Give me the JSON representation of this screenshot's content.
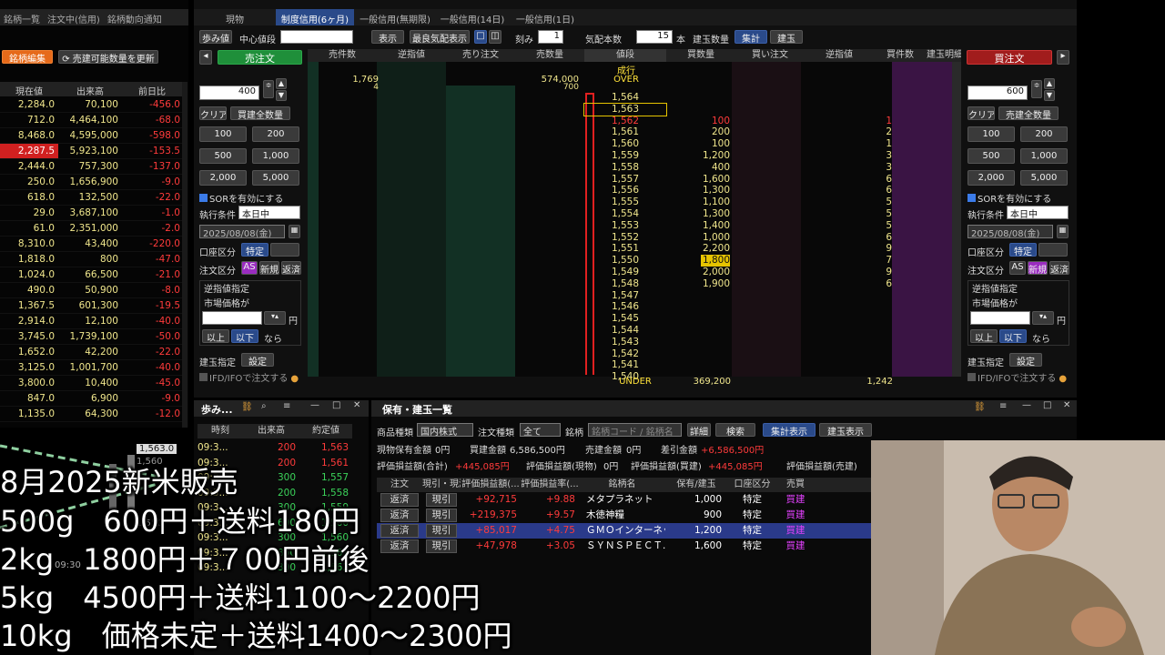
{
  "top_tabs": [
    "銘柄一覧",
    "注文中(信用)",
    "銘柄動向通知"
  ],
  "mid_tabs": [
    "現物",
    "制度信用(6ヶ月)",
    "一般信用(無期限)",
    "一般信用(14日)",
    "一般信用(1日)"
  ],
  "left_list": {
    "edit_label": "銘柄編集",
    "update_label": "売建可能数量を更新",
    "headers": [
      "現在値",
      "出来高",
      "前日比"
    ],
    "rows": [
      [
        "2,284.0",
        "70,100",
        "-456.0"
      ],
      [
        "712.0",
        "4,464,100",
        "-68.0"
      ],
      [
        "8,468.0",
        "4,595,000",
        "-598.0"
      ],
      [
        "2,287.5",
        "5,923,100",
        "-153.5"
      ],
      [
        "2,444.0",
        "757,300",
        "-137.0"
      ],
      [
        "250.0",
        "1,656,900",
        "-9.0"
      ],
      [
        "618.0",
        "132,500",
        "-22.0"
      ],
      [
        "29.0",
        "3,687,100",
        "-1.0"
      ],
      [
        "61.0",
        "2,351,000",
        "-2.0"
      ],
      [
        "8,310.0",
        "43,400",
        "-220.0"
      ],
      [
        "1,818.0",
        "800",
        "-47.0"
      ],
      [
        "1,024.0",
        "66,500",
        "-21.0"
      ],
      [
        "490.0",
        "50,900",
        "-8.0"
      ],
      [
        "1,367.5",
        "601,300",
        "-19.5"
      ],
      [
        "2,914.0",
        "12,100",
        "-40.0"
      ],
      [
        "3,745.0",
        "1,739,100",
        "-50.0"
      ],
      [
        "1,652.0",
        "42,200",
        "-22.0"
      ],
      [
        "3,125.0",
        "1,001,700",
        "-40.0"
      ],
      [
        "3,800.0",
        "10,400",
        "-45.0"
      ],
      [
        "847.0",
        "6,900",
        "-9.0"
      ],
      [
        "1,135.0",
        "64,300",
        "-12.0"
      ]
    ]
  },
  "board_toolbar": {
    "ayumi": "歩み値",
    "center_label": "中心値段",
    "display": "表示",
    "best": "最良気配表示",
    "tick_label": "刻み",
    "tick_value": "1",
    "quote_count_label": "気配本数",
    "quote_count_value": "15",
    "unit": "本",
    "position_label": "建玉数量",
    "agg": "集計",
    "pos": "建玉"
  },
  "board_headers": [
    "売件数",
    "逆指値",
    "売り注文",
    "売数量",
    "値段",
    "買数量",
    "買い注文",
    "逆指値",
    "買件数",
    "建玉明細"
  ],
  "board_top": {
    "nari": "成行",
    "over": "OVER",
    "over_sell_count": "1,769",
    "over_sell_count2": "4",
    "over_sell_qty": "574,000",
    "over_sell_qty2": "700",
    "under": "UNDER",
    "under_buy_qty": "369,200",
    "under_buy_count": "1,242"
  },
  "board_rows": [
    {
      "price": "1,564",
      "bq": "",
      "bc": ""
    },
    {
      "price": "1,563",
      "bq": "",
      "bc": ""
    },
    {
      "price": "1,562",
      "bq": "100",
      "bc": "1"
    },
    {
      "price": "1,561",
      "bq": "200",
      "bc": "2"
    },
    {
      "price": "1,560",
      "bq": "100",
      "bc": "1"
    },
    {
      "price": "1,559",
      "bq": "1,200",
      "bc": "3"
    },
    {
      "price": "1,558",
      "bq": "400",
      "bc": "3"
    },
    {
      "price": "1,557",
      "bq": "1,600",
      "bc": "6"
    },
    {
      "price": "1,556",
      "bq": "1,300",
      "bc": "6"
    },
    {
      "price": "1,555",
      "bq": "1,100",
      "bc": "5"
    },
    {
      "price": "1,554",
      "bq": "1,300",
      "bc": "5"
    },
    {
      "price": "1,553",
      "bq": "1,400",
      "bc": "5"
    },
    {
      "price": "1,552",
      "bq": "1,000",
      "bc": "6"
    },
    {
      "price": "1,551",
      "bq": "2,200",
      "bc": "9"
    },
    {
      "price": "1,550",
      "bq": "1,800",
      "bc": "7"
    },
    {
      "price": "1,549",
      "bq": "2,000",
      "bc": "9"
    },
    {
      "price": "1,548",
      "bq": "1,900",
      "bc": "6"
    },
    {
      "price": "1,547",
      "bq": "",
      "bc": ""
    },
    {
      "price": "1,546",
      "bq": "",
      "bc": ""
    },
    {
      "price": "1,545",
      "bq": "",
      "bc": ""
    },
    {
      "price": "1,544",
      "bq": "",
      "bc": ""
    },
    {
      "price": "1,543",
      "bq": "",
      "bc": ""
    },
    {
      "price": "1,542",
      "bq": "",
      "bc": ""
    },
    {
      "price": "1,541",
      "bq": "",
      "bc": ""
    },
    {
      "price": "1,540",
      "bq": "",
      "bc": ""
    }
  ],
  "sell_panel": {
    "title": "売注文",
    "qty": "400",
    "clear": "クリア",
    "all": "買建全数量",
    "q100": "100",
    "q200": "200",
    "q500": "500",
    "q1000": "1,000",
    "q2000": "2,000",
    "q5000": "5,000",
    "sor": "SORを有効にする",
    "cond_label": "執行条件",
    "cond_value": "本日中",
    "date": "2025/08/08(金)",
    "acct_label": "口座区分",
    "acct_value": "特定",
    "kind_label": "注文区分",
    "as": "AS",
    "new": "新規",
    "close": "返済",
    "stop_title": "逆指値指定",
    "market_price": "市場価格が",
    "yen": "円",
    "ijo": "以上",
    "ika": "以下",
    "nara": "なら",
    "pos_label": "建玉指定",
    "setting": "設定",
    "ifd": "IFD/IFOで注文する"
  },
  "buy_panel": {
    "title": "買注文",
    "qty": "600",
    "clear": "クリア",
    "all": "売建全数量",
    "q100": "100",
    "q200": "200",
    "q500": "500",
    "q1000": "1,000",
    "q2000": "2,000",
    "q5000": "5,000",
    "sor": "SORを有効にする",
    "cond_label": "執行条件",
    "cond_value": "本日中",
    "date": "2025/08/08(金)",
    "acct_label": "口座区分",
    "acct_value": "特定",
    "kind_label": "注文区分",
    "as": "AS",
    "new": "新規",
    "close": "返済",
    "stop_title": "逆指値指定",
    "market_price": "市場価格が",
    "yen": "円",
    "ijo": "以上",
    "ika": "以下",
    "nara": "なら",
    "pos_label": "建玉指定",
    "setting": "設定",
    "ifd": "IFD/IFOで注文する"
  },
  "ayumi_panel": {
    "title": "歩み...",
    "headers": [
      "時刻",
      "出来高",
      "約定値"
    ],
    "rows": [
      [
        "09:3...",
        "200",
        "1,563"
      ],
      [
        "09:3...",
        "200",
        "1,561"
      ],
      [
        "09:3...",
        "300",
        "1,557"
      ],
      [
        "09:3...",
        "200",
        "1,558"
      ],
      [
        "09:3...",
        "300",
        "1,559"
      ],
      [
        "09:3...",
        "600",
        "1,560"
      ],
      [
        "09:3...",
        "300",
        "1,560"
      ],
      [
        "09:3...",
        "800",
        "1,561"
      ],
      [
        "09:3...",
        "300",
        "1,562"
      ]
    ]
  },
  "chart": {
    "price_tag": "1,563.0",
    "y1": "1,560",
    "y2": "1,550",
    "time": "09:30"
  },
  "holdings": {
    "title": "保有・建玉一覧",
    "product_label": "商品種類",
    "product_value": "国内株式",
    "order_kind_label": "注文種類",
    "order_kind_value": "全て",
    "symbol_label": "銘柄",
    "symbol_placeholder": "銘柄コード / 銘柄名",
    "detail": "詳細",
    "search": "検索",
    "agg": "集計表示",
    "pos": "建玉表示",
    "s1_label": "現物保有金額",
    "s1_value": "0円",
    "s2_label": "買建金額",
    "s2_value": "6,586,500円",
    "s3_label": "売建金額",
    "s3_value": "0円",
    "s4_label": "差引金額",
    "s4_value": "+6,586,500円",
    "s5_label": "評価損益額(合計)",
    "s5_value": "+445,085円",
    "s6_label": "評価損益額(現物)",
    "s6_value": "0円",
    "s7_label": "評価損益額(買建)",
    "s7_value": "+445,085円",
    "s8_label": "評価損益額(売建)",
    "headers": [
      "注文",
      "現引・現渡",
      "評価損益額(...",
      "評価損益率(...",
      "銘柄名",
      "保有/建玉",
      "口座区分",
      "売買"
    ],
    "rows": [
      [
        "返済",
        "現引",
        "+92,715",
        "+9.88",
        "メタプラネット",
        "1,000",
        "特定",
        "買建"
      ],
      [
        "返済",
        "現引",
        "+219,375",
        "+9.57",
        "木徳神糧",
        "900",
        "特定",
        "買建"
      ],
      [
        "返済",
        "現引",
        "+85,017",
        "+4.75",
        "ＧＭＯインターネット",
        "1,200",
        "特定",
        "買建"
      ],
      [
        "返済",
        "現引",
        "+47,978",
        "+3.05",
        "ＳＹＮＳＰＥＣＴ...",
        "1,600",
        "特定",
        "買建"
      ]
    ]
  },
  "overlay_lines": [
    "8月2025新米販売",
    "500g　600円＋送料180円",
    "2kg　1800円＋７00円前後",
    "5kg　4500円＋送料1100～2200円",
    "10kg　価格未定＋送料1400～2300円"
  ],
  "colors": {
    "positive": "#ff3b3b",
    "negative": "#ff3b3b",
    "neutral": "#f0e68c",
    "accent": "#2a4a8a"
  }
}
